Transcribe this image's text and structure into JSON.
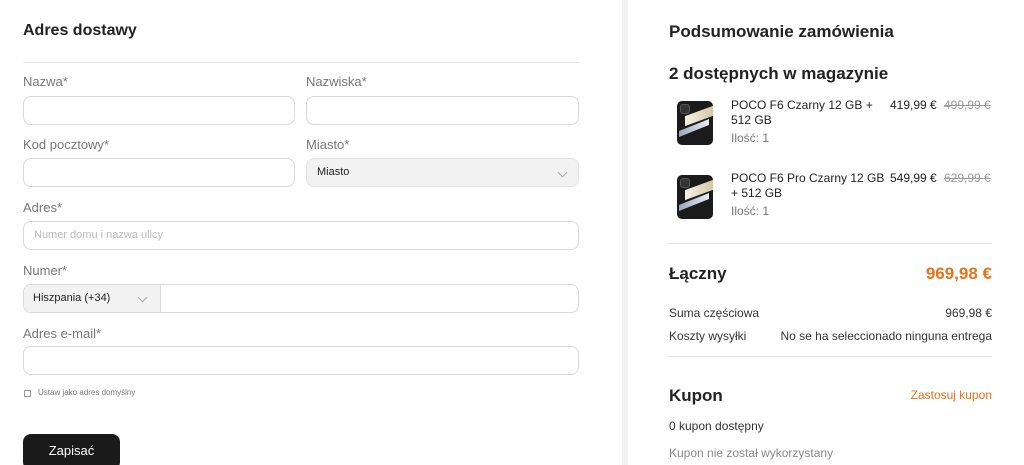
{
  "address": {
    "title": "Adres dostawy",
    "first_name_label": "Nazwa*",
    "last_name_label": "Nazwiska*",
    "postal_label": "Kod pocztowy*",
    "city_label": "Miasto*",
    "city_value": "Miasto",
    "street_label": "Adres*",
    "street_placeholder": "Numer domu i nazwa ulicy",
    "phone_label": "Numer*",
    "phone_country": "Hiszpania (+34)",
    "email_label": "Adres e-mail*",
    "default_checkbox_label": "Ustaw jako adres domyślny",
    "save_label": "Zapisać"
  },
  "summary": {
    "title": "Podsumowanie zamówienia",
    "stock_heading": "2 dostępnych w magazynie",
    "products": [
      {
        "name": "POCO F6 Czarny 12 GB + 512 GB",
        "qty": "Ilość: 1",
        "price": "419,99 €",
        "old_price": "499,99 €"
      },
      {
        "name": "POCO F6 Pro Czarny 12 GB + 512 GB",
        "qty": "Ilość: 1",
        "price": "549,99 €",
        "old_price": "629,99 €"
      }
    ],
    "total_label": "Łączny",
    "total_value": "969,98 €",
    "subtotal_label": "Suma częściowa",
    "subtotal_value": "969,98 €",
    "shipping_label": "Koszty wysyłki",
    "shipping_value": "No se ha seleccionado ninguna entrega"
  },
  "coupon": {
    "title": "Kupon",
    "apply_label": "Zastosuj kupon",
    "available": "0 kupon dostępny",
    "unused": "Kupon nie został wykorzystany"
  },
  "colors": {
    "accent": "#e8711b",
    "button": "#1a1a1a"
  }
}
